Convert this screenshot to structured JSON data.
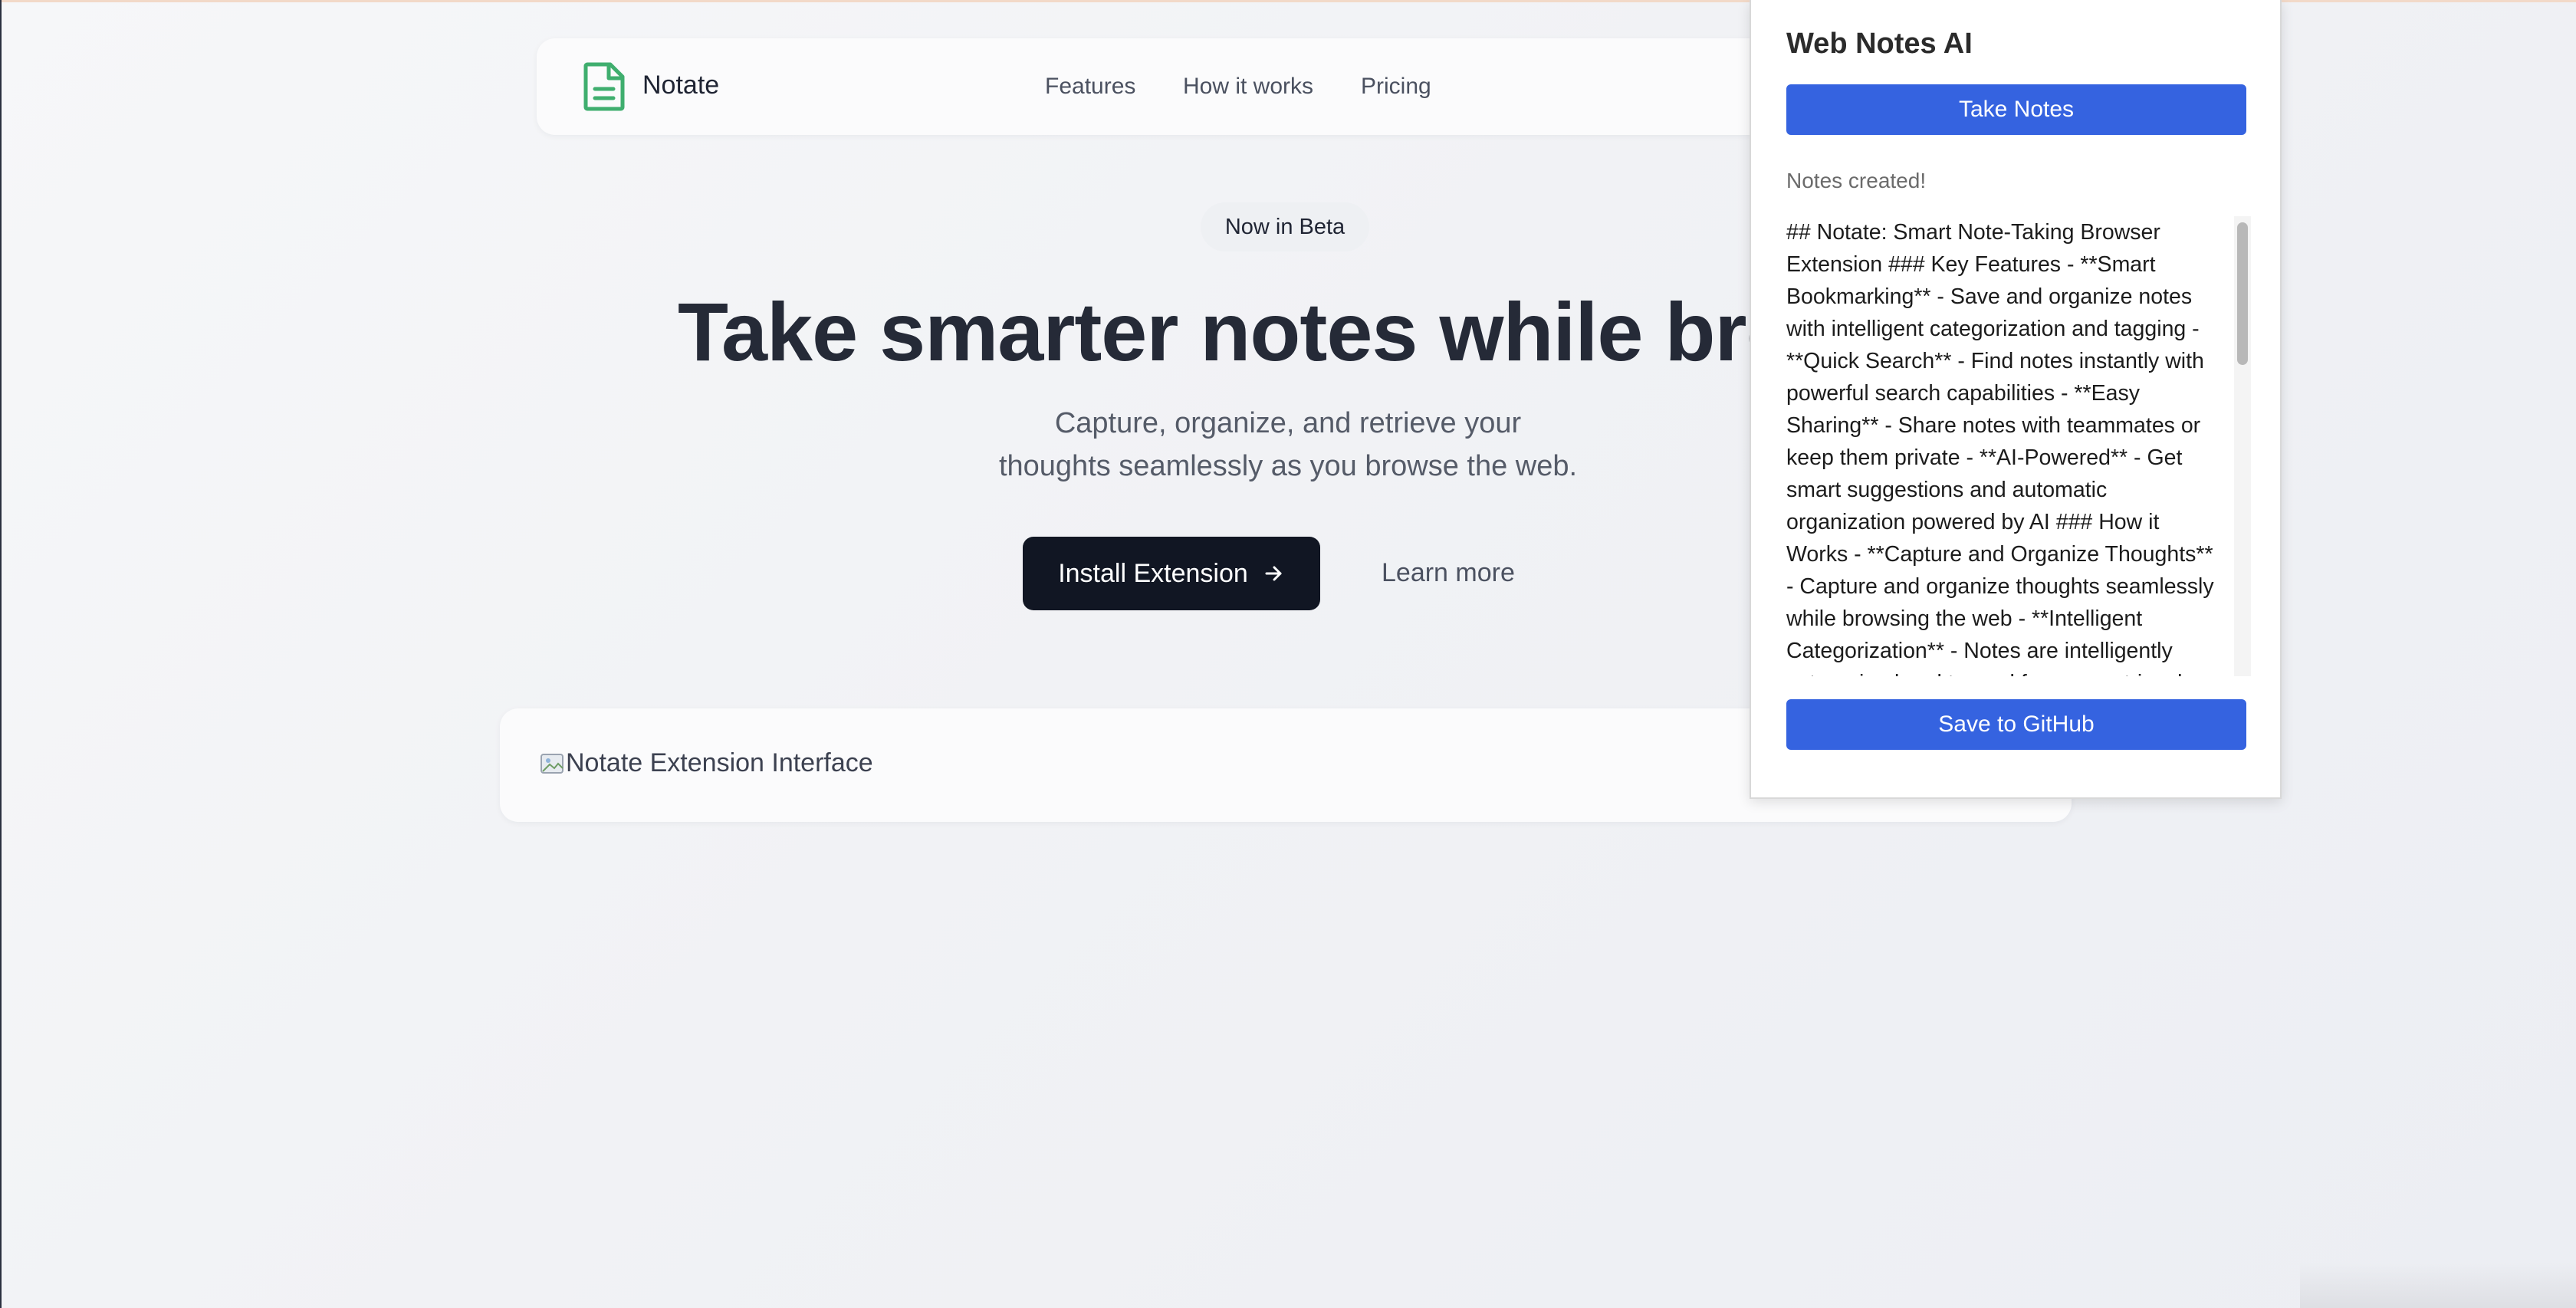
{
  "navbar": {
    "brand": "Notate",
    "links": [
      "Features",
      "How it works",
      "Pricing"
    ]
  },
  "hero": {
    "badge": "Now in Beta",
    "title": "Take smarter notes while brows",
    "subtitle_line1": "Capture, organize, and retrieve your",
    "subtitle_line2": "thoughts seamlessly as you browse the web.",
    "install_label": "Install Extension",
    "learn_more_label": "Learn more"
  },
  "preview": {
    "image_alt": "Notate Extension Interface"
  },
  "popup": {
    "title": "Web Notes AI",
    "take_notes_label": "Take Notes",
    "status": "Notes created!",
    "notes": "## Notate: Smart Note-Taking Browser Extension ### Key Features - **Smart Bookmarking** - Save and organize notes with intelligent categorization and tagging - **Quick Search** - Find notes instantly with powerful search capabilities - **Easy Sharing** - Share notes with teammates or keep them private - **AI-Powered** - Get smart suggestions and automatic organization powered by AI ### How it Works - **Capture and Organize Thoughts** - Capture and organize thoughts seamlessly while browsing the web - **Intelligent Categorization** - Notes are intelligently categorized and tagged for easy retrieval",
    "save_label": "Save to GitHub"
  },
  "colors": {
    "accent_blue": "#3563e0",
    "logo_green": "#3fae6e",
    "button_dark": "#111623"
  },
  "icons": {
    "logo": "document-icon",
    "arrow": "arrow-right-icon",
    "broken_image": "broken-image-icon"
  }
}
